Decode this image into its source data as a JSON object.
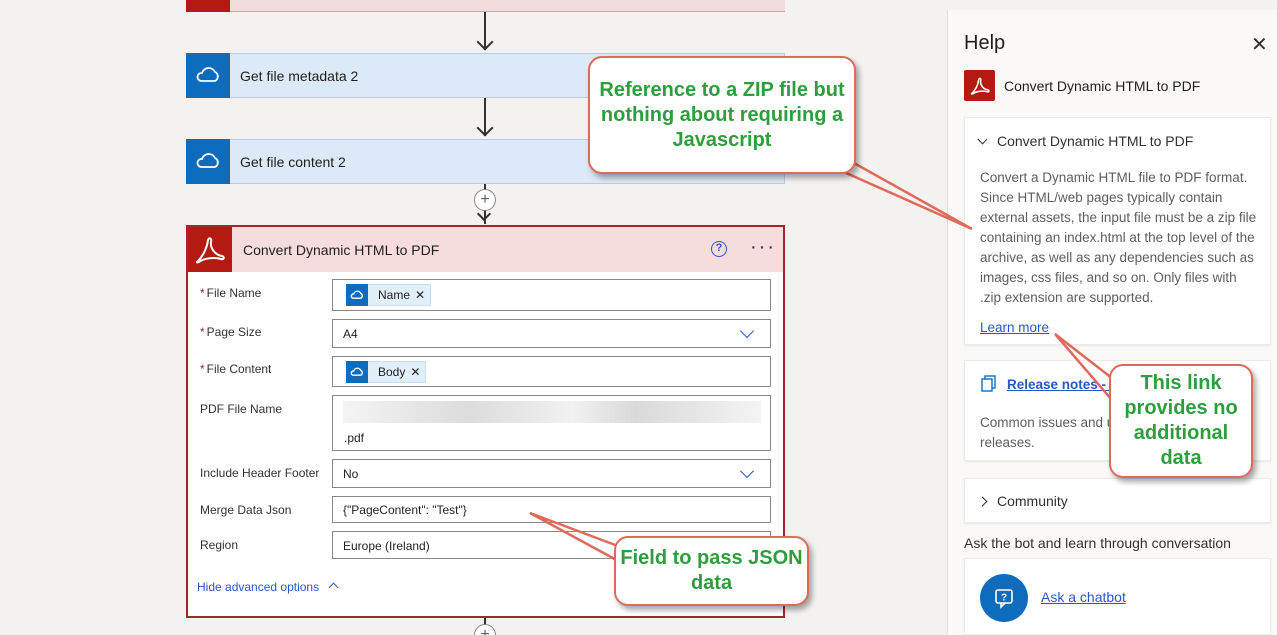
{
  "flow": {
    "steps": [
      {
        "label": "Get file metadata 2",
        "icon": "cloud-icon"
      },
      {
        "label": "Get file content 2",
        "icon": "cloud-icon"
      }
    ],
    "action": {
      "title": "Convert Dynamic HTML to PDF",
      "icon": "acrobat-icon",
      "help_glyph": "?",
      "more_glyph": "···",
      "fields": {
        "file_name": {
          "label": "File Name",
          "token": "Name"
        },
        "page_size": {
          "label": "Page Size",
          "value": "A4"
        },
        "file_content": {
          "label": "File Content",
          "token": "Body"
        },
        "pdf_file_name": {
          "label": "PDF File Name",
          "suffix": ".pdf"
        },
        "header_footer": {
          "label": "Include Header Footer",
          "value": "No"
        },
        "merge_json": {
          "label": "Merge Data Json",
          "value": "{\"PageContent\": \"Test\"}"
        },
        "region": {
          "label": "Region",
          "value": "Europe (Ireland)"
        }
      },
      "required_mark": "*",
      "token_remove": "✕",
      "hide_advanced": "Hide advanced options"
    },
    "plus_glyph": "+"
  },
  "help_panel": {
    "title": "Help",
    "close_glyph": "✕",
    "connector_name": "Convert Dynamic HTML to PDF",
    "section_title": "Convert Dynamic HTML to PDF",
    "description": "Convert a Dynamic HTML file to PDF format. Since HTML/web pages typically contain external assets, the input file must be a zip file containing an index.html at the top level of the archive, as well as any dependencies such as images, css files, and so on. Only files with .zip extension are supported.",
    "learn_more": "Learn more",
    "release_notes_link": "Release notes - P",
    "release_notes_desc": "Common issues and u Automate releases.",
    "community": "Community",
    "ask_bot_heading": "Ask the bot and learn through conversation",
    "chatbot_link": "Ask a chatbot"
  },
  "callouts": {
    "zip": "Reference to a ZIP file but nothing about requiring a Javascript",
    "link": "This link provides no additional data",
    "json": "Field to pass JSON data"
  },
  "colors": {
    "accent_blue": "#0f6cbd",
    "acrobat_red": "#b51a12",
    "callout_green": "#2e9e3c",
    "callout_border": "#e06a5a"
  }
}
